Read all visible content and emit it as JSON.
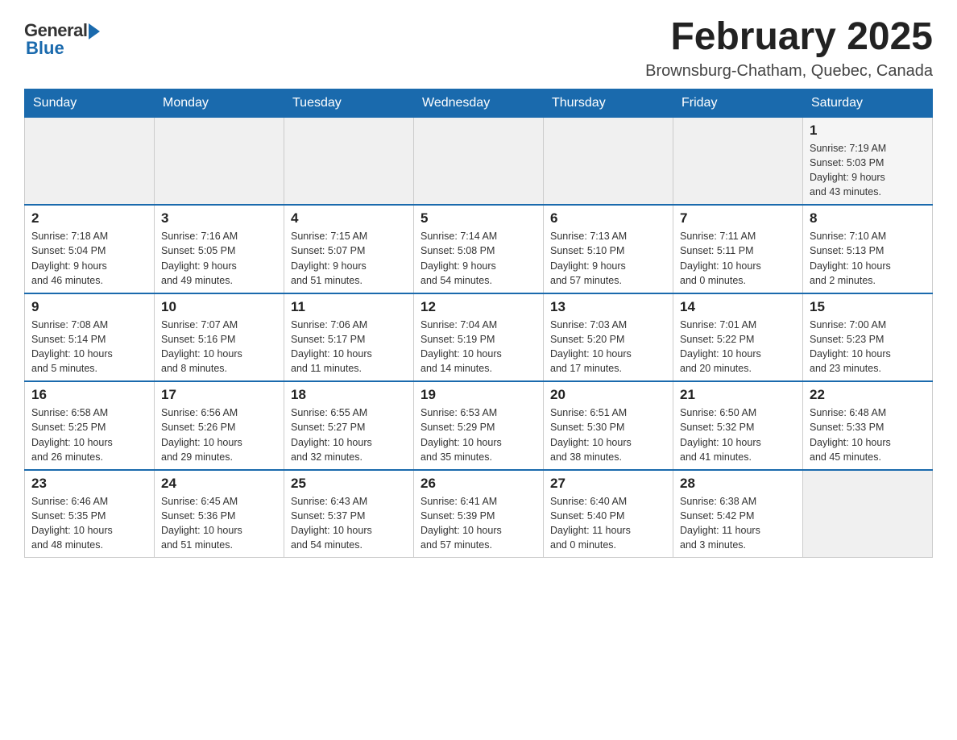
{
  "logo": {
    "general": "General",
    "blue": "Blue"
  },
  "title": "February 2025",
  "subtitle": "Brownsburg-Chatham, Quebec, Canada",
  "days_of_week": [
    "Sunday",
    "Monday",
    "Tuesday",
    "Wednesday",
    "Thursday",
    "Friday",
    "Saturday"
  ],
  "weeks": [
    [
      {
        "day": "",
        "info": ""
      },
      {
        "day": "",
        "info": ""
      },
      {
        "day": "",
        "info": ""
      },
      {
        "day": "",
        "info": ""
      },
      {
        "day": "",
        "info": ""
      },
      {
        "day": "",
        "info": ""
      },
      {
        "day": "1",
        "info": "Sunrise: 7:19 AM\nSunset: 5:03 PM\nDaylight: 9 hours\nand 43 minutes."
      }
    ],
    [
      {
        "day": "2",
        "info": "Sunrise: 7:18 AM\nSunset: 5:04 PM\nDaylight: 9 hours\nand 46 minutes."
      },
      {
        "day": "3",
        "info": "Sunrise: 7:16 AM\nSunset: 5:05 PM\nDaylight: 9 hours\nand 49 minutes."
      },
      {
        "day": "4",
        "info": "Sunrise: 7:15 AM\nSunset: 5:07 PM\nDaylight: 9 hours\nand 51 minutes."
      },
      {
        "day": "5",
        "info": "Sunrise: 7:14 AM\nSunset: 5:08 PM\nDaylight: 9 hours\nand 54 minutes."
      },
      {
        "day": "6",
        "info": "Sunrise: 7:13 AM\nSunset: 5:10 PM\nDaylight: 9 hours\nand 57 minutes."
      },
      {
        "day": "7",
        "info": "Sunrise: 7:11 AM\nSunset: 5:11 PM\nDaylight: 10 hours\nand 0 minutes."
      },
      {
        "day": "8",
        "info": "Sunrise: 7:10 AM\nSunset: 5:13 PM\nDaylight: 10 hours\nand 2 minutes."
      }
    ],
    [
      {
        "day": "9",
        "info": "Sunrise: 7:08 AM\nSunset: 5:14 PM\nDaylight: 10 hours\nand 5 minutes."
      },
      {
        "day": "10",
        "info": "Sunrise: 7:07 AM\nSunset: 5:16 PM\nDaylight: 10 hours\nand 8 minutes."
      },
      {
        "day": "11",
        "info": "Sunrise: 7:06 AM\nSunset: 5:17 PM\nDaylight: 10 hours\nand 11 minutes."
      },
      {
        "day": "12",
        "info": "Sunrise: 7:04 AM\nSunset: 5:19 PM\nDaylight: 10 hours\nand 14 minutes."
      },
      {
        "day": "13",
        "info": "Sunrise: 7:03 AM\nSunset: 5:20 PM\nDaylight: 10 hours\nand 17 minutes."
      },
      {
        "day": "14",
        "info": "Sunrise: 7:01 AM\nSunset: 5:22 PM\nDaylight: 10 hours\nand 20 minutes."
      },
      {
        "day": "15",
        "info": "Sunrise: 7:00 AM\nSunset: 5:23 PM\nDaylight: 10 hours\nand 23 minutes."
      }
    ],
    [
      {
        "day": "16",
        "info": "Sunrise: 6:58 AM\nSunset: 5:25 PM\nDaylight: 10 hours\nand 26 minutes."
      },
      {
        "day": "17",
        "info": "Sunrise: 6:56 AM\nSunset: 5:26 PM\nDaylight: 10 hours\nand 29 minutes."
      },
      {
        "day": "18",
        "info": "Sunrise: 6:55 AM\nSunset: 5:27 PM\nDaylight: 10 hours\nand 32 minutes."
      },
      {
        "day": "19",
        "info": "Sunrise: 6:53 AM\nSunset: 5:29 PM\nDaylight: 10 hours\nand 35 minutes."
      },
      {
        "day": "20",
        "info": "Sunrise: 6:51 AM\nSunset: 5:30 PM\nDaylight: 10 hours\nand 38 minutes."
      },
      {
        "day": "21",
        "info": "Sunrise: 6:50 AM\nSunset: 5:32 PM\nDaylight: 10 hours\nand 41 minutes."
      },
      {
        "day": "22",
        "info": "Sunrise: 6:48 AM\nSunset: 5:33 PM\nDaylight: 10 hours\nand 45 minutes."
      }
    ],
    [
      {
        "day": "23",
        "info": "Sunrise: 6:46 AM\nSunset: 5:35 PM\nDaylight: 10 hours\nand 48 minutes."
      },
      {
        "day": "24",
        "info": "Sunrise: 6:45 AM\nSunset: 5:36 PM\nDaylight: 10 hours\nand 51 minutes."
      },
      {
        "day": "25",
        "info": "Sunrise: 6:43 AM\nSunset: 5:37 PM\nDaylight: 10 hours\nand 54 minutes."
      },
      {
        "day": "26",
        "info": "Sunrise: 6:41 AM\nSunset: 5:39 PM\nDaylight: 10 hours\nand 57 minutes."
      },
      {
        "day": "27",
        "info": "Sunrise: 6:40 AM\nSunset: 5:40 PM\nDaylight: 11 hours\nand 0 minutes."
      },
      {
        "day": "28",
        "info": "Sunrise: 6:38 AM\nSunset: 5:42 PM\nDaylight: 11 hours\nand 3 minutes."
      },
      {
        "day": "",
        "info": ""
      }
    ]
  ]
}
